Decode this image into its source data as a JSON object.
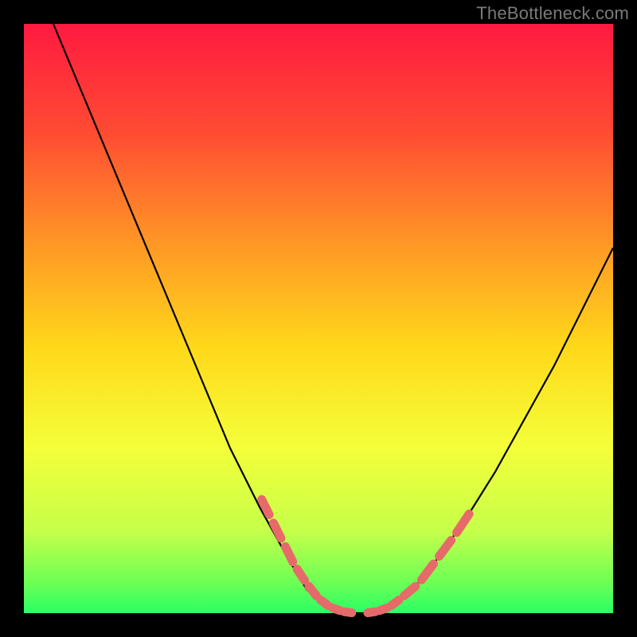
{
  "attribution": "TheBottleneck.com",
  "colors": {
    "background": "#000000",
    "gradient_top": "#ff1a40",
    "gradient_mid_upper": "#ff6a2a",
    "gradient_mid": "#ffd91a",
    "gradient_mid_lower": "#f4ff3a",
    "gradient_lower": "#aaff55",
    "gradient_bottom": "#2aff66",
    "curve": "#000000",
    "segments": "#e66a6a"
  },
  "chart_data": {
    "type": "line",
    "title": "",
    "xlabel": "",
    "ylabel": "",
    "xlim": [
      0,
      100
    ],
    "ylim": [
      0,
      100
    ],
    "series": [
      {
        "name": "curve",
        "x": [
          0,
          5,
          10,
          15,
          20,
          25,
          30,
          35,
          40,
          45,
          48,
          51,
          55,
          58,
          62,
          66,
          70,
          75,
          80,
          85,
          90,
          95,
          100
        ],
        "y": [
          112,
          100,
          88,
          76,
          64,
          52,
          40,
          28,
          18,
          9,
          4,
          1,
          0,
          0,
          1,
          4,
          9,
          16,
          24,
          33,
          42,
          52,
          62
        ]
      }
    ],
    "highlighted_segments": [
      {
        "name": "left-arm",
        "points": [
          {
            "x": 40,
            "y": 20
          },
          {
            "x": 42,
            "y": 16
          },
          {
            "x": 44,
            "y": 12
          },
          {
            "x": 46,
            "y": 8
          },
          {
            "x": 48,
            "y": 5
          },
          {
            "x": 50,
            "y": 2.5
          },
          {
            "x": 52,
            "y": 1
          },
          {
            "x": 54,
            "y": 0.3
          },
          {
            "x": 56,
            "y": 0
          }
        ]
      },
      {
        "name": "right-arm",
        "points": [
          {
            "x": 58,
            "y": 0
          },
          {
            "x": 60,
            "y": 0.3
          },
          {
            "x": 62,
            "y": 1
          },
          {
            "x": 64,
            "y": 2.5
          },
          {
            "x": 67,
            "y": 5
          },
          {
            "x": 70,
            "y": 9
          },
          {
            "x": 73,
            "y": 13
          },
          {
            "x": 76,
            "y": 17.5
          }
        ]
      }
    ],
    "annotations": []
  }
}
